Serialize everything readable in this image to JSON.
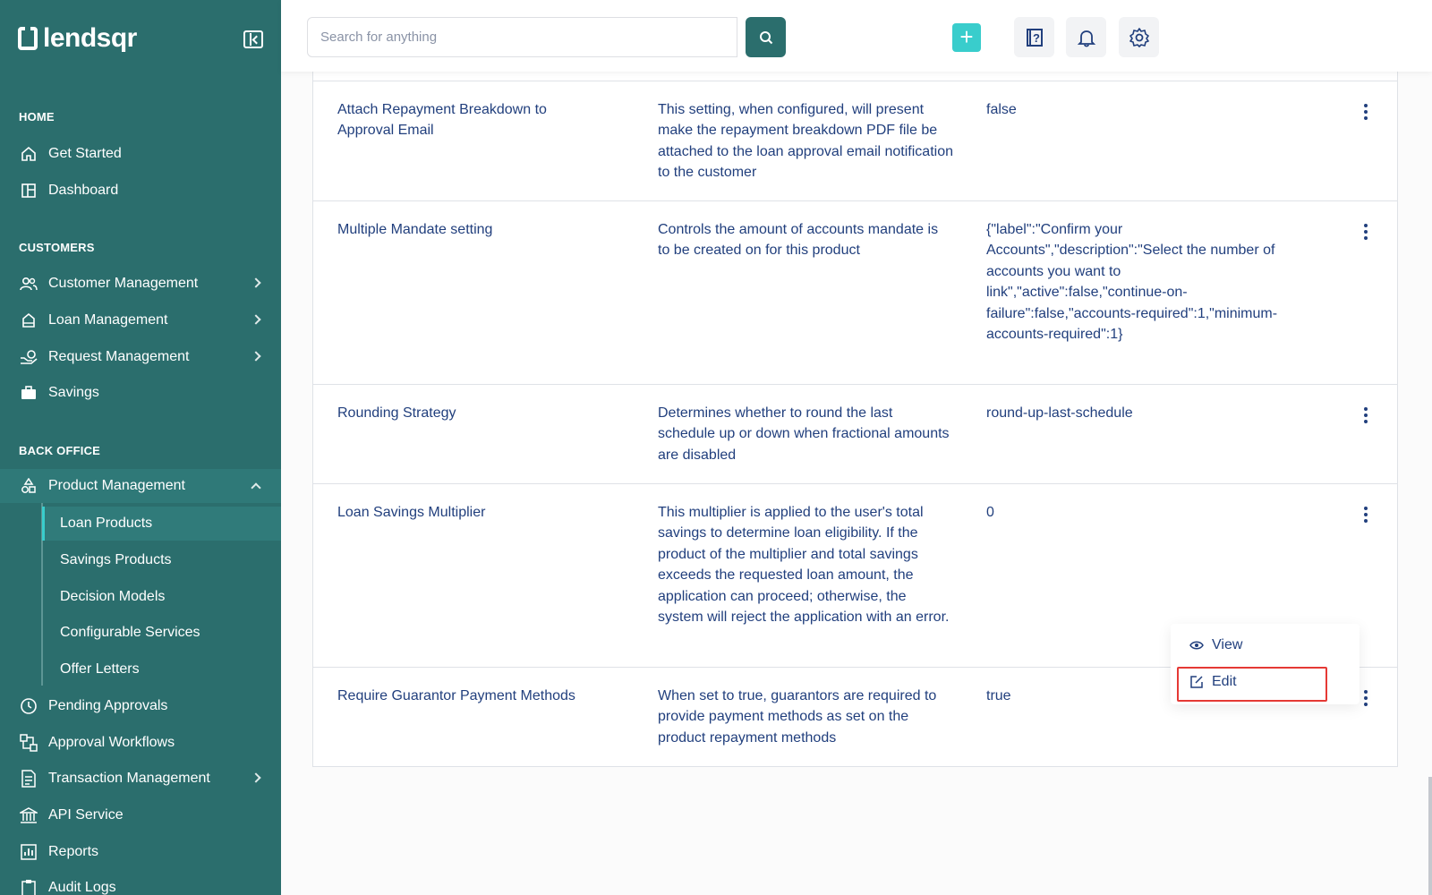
{
  "brand": {
    "name": "lendsqr"
  },
  "search": {
    "placeholder": "Search for anything"
  },
  "sidebar": {
    "sections": {
      "home": "HOME",
      "customers": "CUSTOMERS",
      "back_office": "BACK OFFICE"
    },
    "items": {
      "get_started": "Get Started",
      "dashboard": "Dashboard",
      "customer_management": "Customer Management",
      "loan_management": "Loan Management",
      "request_management": "Request Management",
      "savings": "Savings",
      "product_management": "Product Management",
      "pending_approvals": "Pending Approvals",
      "approval_workflows": "Approval Workflows",
      "transaction_management": "Transaction Management",
      "api_service": "API Service",
      "reports": "Reports",
      "audit_logs": "Audit Logs"
    },
    "sub_items": {
      "loan_products": "Loan Products",
      "savings_products": "Savings Products",
      "decision_models": "Decision Models",
      "configurable_services": "Configurable Services",
      "offer_letters": "Offer Letters"
    }
  },
  "table": {
    "rows": [
      {
        "name": "Attach Repayment Breakdown to Approval Email",
        "description": "This setting, when configured, will present make the repayment breakdown PDF file be attached to the loan approval email notification to the customer",
        "value": "false"
      },
      {
        "name": "Multiple Mandate setting",
        "description": "Controls the amount of accounts mandate is to be created on for this product",
        "value": "{\"label\":\"Confirm your Accounts\",\"description\":\"Select the number of accounts you want to link\",\"active\":false,\"continue-on-failure\":false,\"accounts-required\":1,\"minimum-accounts-required\":1}"
      },
      {
        "name": "Rounding Strategy",
        "description": "Determines whether to round the last schedule up or down when fractional amounts are disabled",
        "value": "round-up-last-schedule"
      },
      {
        "name": "Loan Savings Multiplier",
        "description": "This multiplier is applied to the user's total savings to determine loan eligibility. If the product of the multiplier and total savings exceeds the requested loan amount, the application can proceed; otherwise, the system will reject the application with an error.",
        "value": "0"
      },
      {
        "name": "Require Guarantor Payment Methods",
        "description": "When set to true, guarantors are required to provide payment methods as set on the product repayment methods",
        "value": "true"
      }
    ]
  },
  "menu": {
    "view": "View",
    "edit": "Edit"
  },
  "colors": {
    "sidebar": "#2b6e6d",
    "accent": "#39cdcc",
    "text": "#213f7d",
    "highlight": "#e53935"
  }
}
